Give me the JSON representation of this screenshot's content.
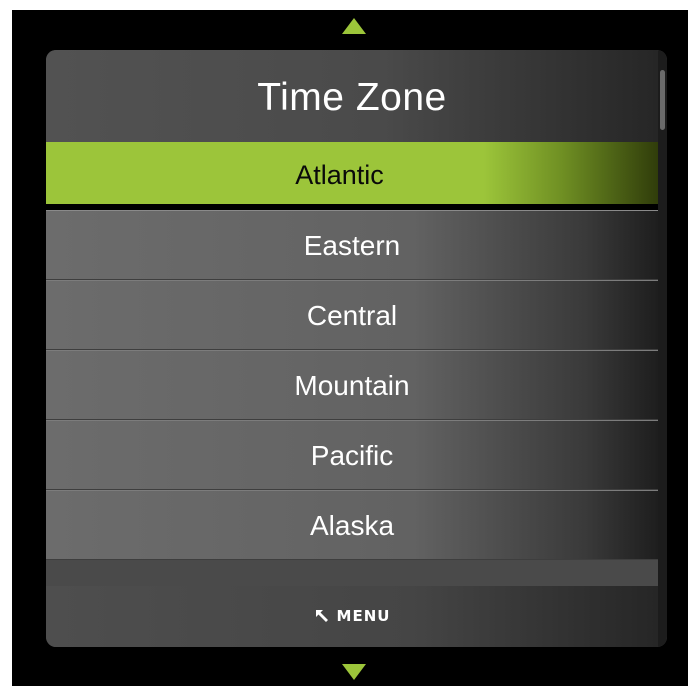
{
  "colors": {
    "accent": "#9cc53a",
    "panel": "#4a4a4a",
    "background": "#000000"
  },
  "panel": {
    "title": "Time Zone"
  },
  "list": {
    "items": [
      {
        "label": "Atlantic",
        "selected": true
      },
      {
        "label": "Eastern",
        "selected": false
      },
      {
        "label": "Central",
        "selected": false
      },
      {
        "label": "Mountain",
        "selected": false
      },
      {
        "label": "Pacific",
        "selected": false
      },
      {
        "label": "Alaska",
        "selected": false
      }
    ]
  },
  "footer": {
    "menu_label": "MENU",
    "menu_icon": "back-arrow-icon"
  },
  "navigation": {
    "up_icon": "triangle-up-icon",
    "down_icon": "triangle-down-icon"
  }
}
